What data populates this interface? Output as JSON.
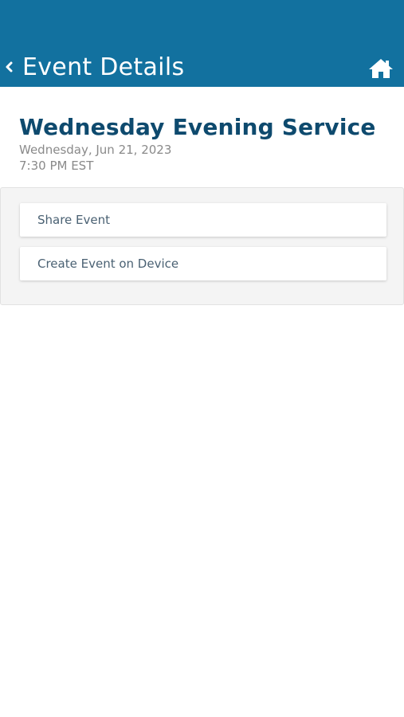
{
  "header": {
    "title": "Event Details",
    "background_color": "#12719f",
    "back_icon": "chevron-left-icon",
    "home_icon": "home-icon"
  },
  "event": {
    "title": "Wednesday Evening Service",
    "date": "Wednesday, Jun 21, 2023",
    "time": "7:30 PM EST",
    "title_color": "#0e4a6e"
  },
  "actions": [
    {
      "label": "Share Event"
    },
    {
      "label": "Create Event on Device"
    }
  ]
}
